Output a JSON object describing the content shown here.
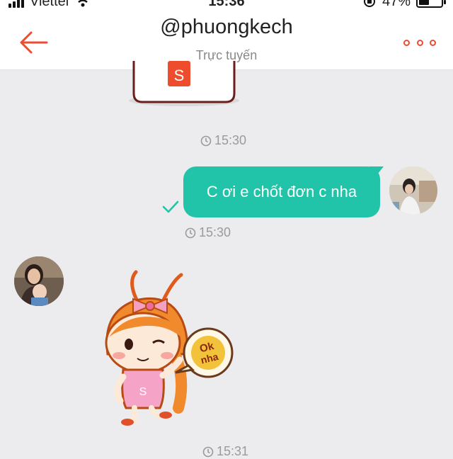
{
  "status_bar": {
    "carrier": "Viettel",
    "time": "15:36",
    "battery": "47%",
    "battery_level": 0.47
  },
  "header": {
    "title": "@phuongkech",
    "subtitle": "Trực tuyến"
  },
  "messages": [
    {
      "type": "sticker",
      "from": "other",
      "timestamp": "15:30"
    },
    {
      "type": "text",
      "from": "me",
      "text": "C ơi e chốt đơn c nha",
      "timestamp": "15:30",
      "status": "sent"
    },
    {
      "type": "sticker",
      "from": "other",
      "sticker_text": "Ok nha",
      "timestamp": "15:31"
    }
  ],
  "colors": {
    "accent": "#ee4d2d",
    "bubble": "#21c4a8",
    "background": "#ececee"
  },
  "icons": [
    "back-arrow-icon",
    "more-options-icon",
    "clock-icon",
    "check-icon",
    "wifi-icon",
    "signal-icon",
    "battery-icon"
  ]
}
